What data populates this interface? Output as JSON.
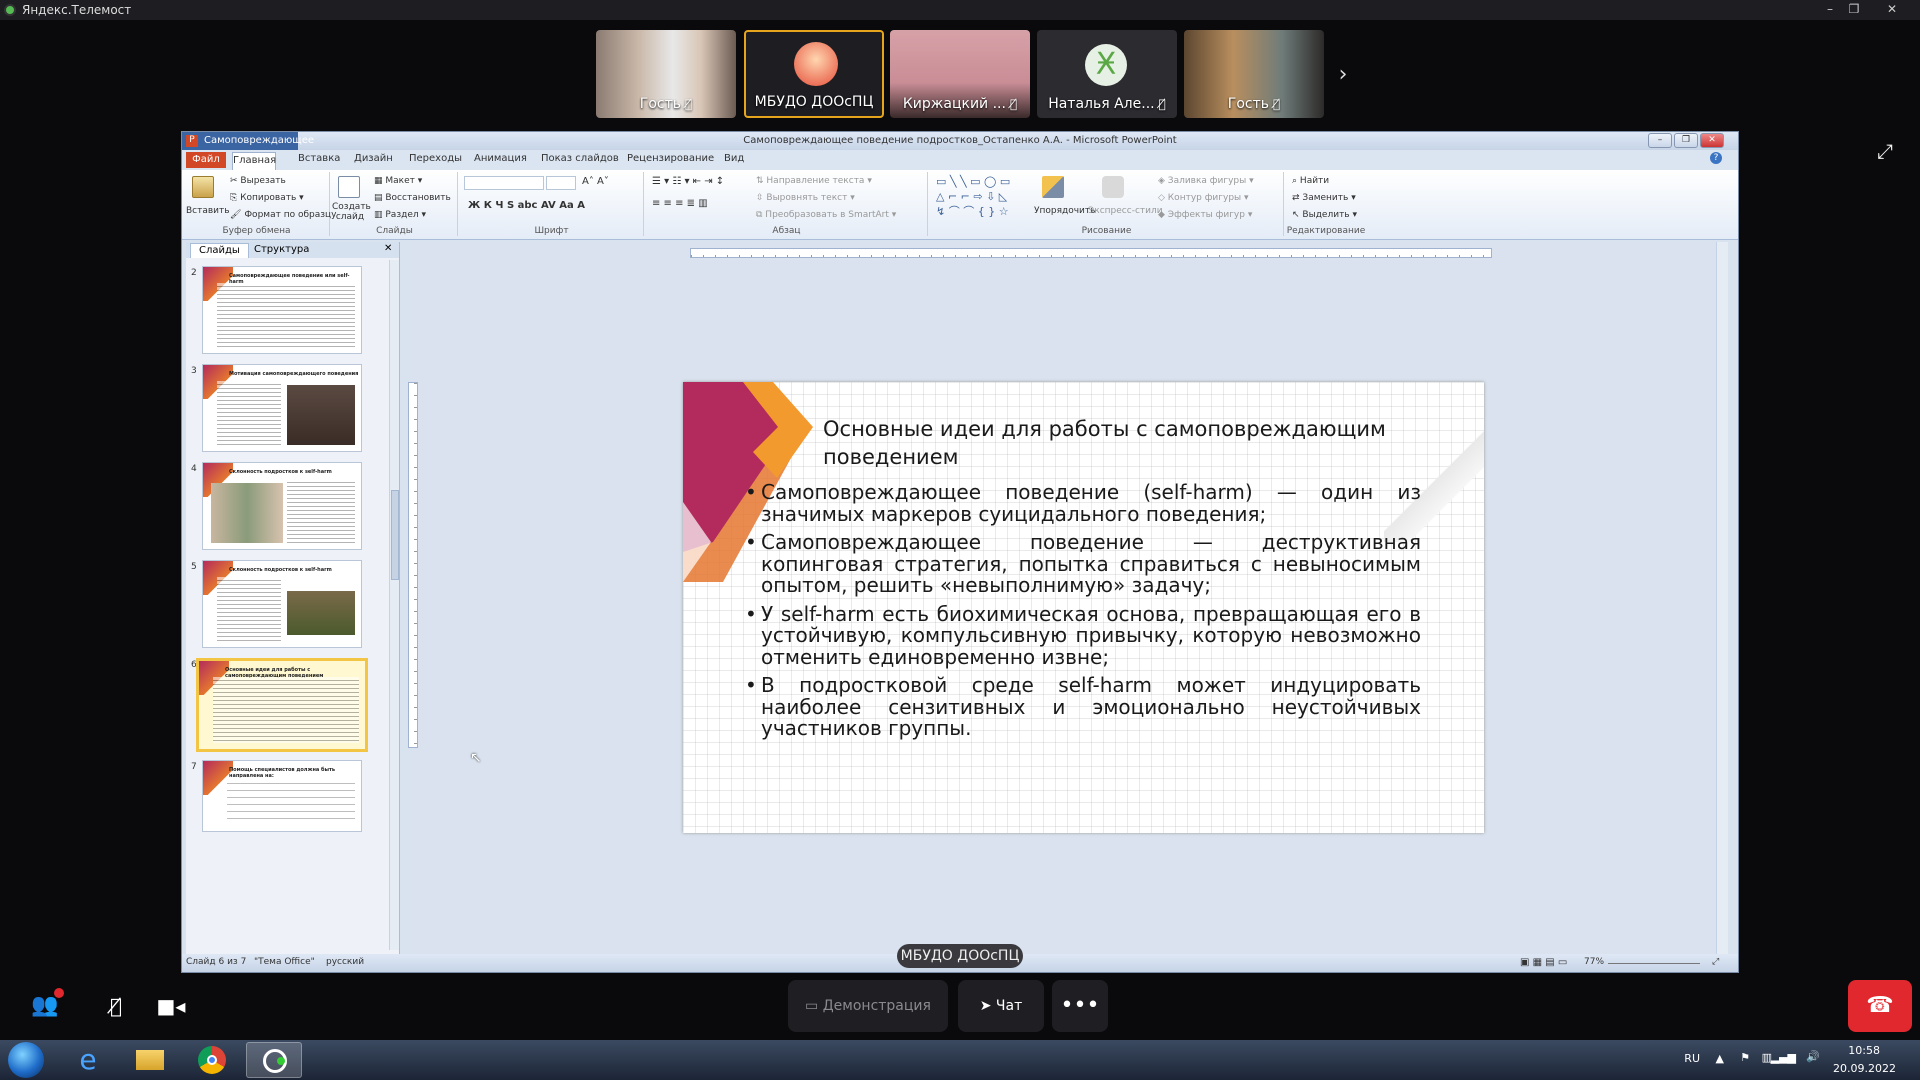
{
  "app": {
    "window_title": "Яндекс.Телемост"
  },
  "participants": [
    {
      "name": "Гость",
      "muted": true
    },
    {
      "name": "МБУДО ДООсПЦ",
      "muted": false
    },
    {
      "name": "Киржацкий ...",
      "muted": true
    },
    {
      "name": "Наталья Але...",
      "muted": true
    },
    {
      "name": "Гость",
      "muted": true
    }
  ],
  "ppt": {
    "tab_title": "Самоповреждающее",
    "doc_title": "Самоповреждающее поведение подростков_Остапенко А.А. - Microsoft PowerPoint",
    "tabs": [
      "Файл",
      "Главная",
      "Вставка",
      "Дизайн",
      "Переходы",
      "Анимация",
      "Показ слайдов",
      "Рецензирование",
      "Вид"
    ],
    "ribbon": {
      "clipboard": {
        "paste": "Вставить",
        "cut": "Вырезать",
        "copy": "Копировать",
        "format_painter": "Формат по образцу",
        "label": "Буфер обмена"
      },
      "slides": {
        "create": "Создать слайд",
        "layout": "Макет",
        "reset": "Восстановить",
        "section": "Раздел",
        "label": "Слайды"
      },
      "font": {
        "label": "Шрифт"
      },
      "paragraph": {
        "text_direction": "Направление текста",
        "align_text": "Выровнять текст",
        "smartart": "Преобразовать в SmartArt",
        "label": "Абзац"
      },
      "drawing": {
        "arrange": "Упорядочить",
        "quick_styles": "Экспресс-стили",
        "fill": "Заливка фигуры",
        "outline": "Контур фигуры",
        "effects": "Эффекты фигур",
        "label": "Рисование"
      },
      "editing": {
        "find": "Найти",
        "replace": "Заменить",
        "select": "Выделить",
        "label": "Редактирование"
      }
    },
    "pane_tabs": [
      "Слайды",
      "Структура"
    ],
    "thumbnails": [
      {
        "num": "2",
        "title": "Самоповреждающее поведение или self-harm"
      },
      {
        "num": "3",
        "title": "Мотивация самоповреждающего поведения"
      },
      {
        "num": "4",
        "title": "Склонность подростков к self-harm"
      },
      {
        "num": "5",
        "title": "Склонность подростков к self-harm"
      },
      {
        "num": "6",
        "title": "Основные идеи для работы с самоповреждающим поведением"
      },
      {
        "num": "7",
        "title": "Помощь специалистов должна быть направлена на:"
      }
    ],
    "slide": {
      "title": "Основные идеи для работы с самоповреждающим поведением",
      "bullets": [
        "Самоповреждающее поведение (self-harm) — один из значимых маркеров суицидального поведения;",
        "Самоповреждающее поведение — деструктивная копинговая стратегия, попытка справиться с невыносимым опытом, решить «невыполнимую» задачу;",
        "У self-harm есть биохимическая основа, превращающая его в устойчивую, компульсивную привычку, которую невозможно отменить единовременно извне;",
        "В подростковой среде self-harm может индуцировать наиболее сензитивных и эмоционально неустойчивых участников группы."
      ]
    },
    "status": {
      "slide_of": "Слайд 6 из 7",
      "theme": "\"Тема Office\"",
      "language": "русский",
      "zoom": "77%"
    }
  },
  "presenter_badge": "МБУДО ДООсПЦ",
  "controls": {
    "demo": "Демонстрация",
    "chat": "Чат"
  },
  "tray": {
    "lang": "RU",
    "time": "10:58",
    "date": "20.09.2022"
  },
  "colors": {
    "accent_active": "#e6a51c",
    "end_call": "#e0282e",
    "slide_chevron_magenta": "#b32b5c",
    "slide_chevron_orange": "#f39a2e"
  }
}
